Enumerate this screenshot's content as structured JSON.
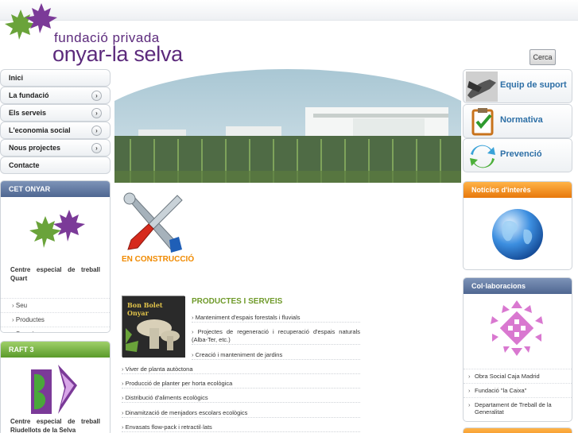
{
  "header": {
    "logo_line1": "fundació privada",
    "logo_line2": "onyar-la selva",
    "search_label": "Cerca"
  },
  "nav": [
    {
      "label": "Inici",
      "has_arrow": false
    },
    {
      "label": "La fundació",
      "has_arrow": true
    },
    {
      "label": "Els serveis",
      "has_arrow": true
    },
    {
      "label": "L'economia social",
      "has_arrow": true
    },
    {
      "label": "Nous projectes",
      "has_arrow": true
    },
    {
      "label": "Contacte",
      "has_arrow": false
    }
  ],
  "cet": {
    "title": "CET ONYAR",
    "text": "Centre especial de treball Quart",
    "links": [
      "Seu",
      "Productes",
      "Serveis"
    ]
  },
  "raft": {
    "title": "RAFT 3",
    "text": "Centre especial de treball Riudellots de la Selva"
  },
  "main": {
    "construction_label": "EN CONSTRUCCIÓ",
    "products_title": "PRODUCTES I SERVEIS",
    "product_image_text": "Bon Bolet Onyar",
    "services_sub": [
      "Manteniment d'espais forestals i fluvials",
      "Projectes de regeneració i recuperació d'espais naturals (Alba-Ter, etc.)",
      "Creació i manteniment de jardins"
    ],
    "services": [
      "Viver de planta autòctona",
      "Producció de planter per horta ecològica",
      "Distribució d'aliments ecològics",
      "Dinamització de menjadors escolars ecològics",
      "Envasats flow-pack i retractil·lats"
    ]
  },
  "right": {
    "buttons": [
      "Equip de suport",
      "Normativa",
      "Prevenció"
    ],
    "news_title": "Notícies d'interès",
    "collab_title": "Col·laboracions",
    "collab_links": [
      "Obra Social Caja Madrid",
      "Fundació \"la Caixa\"",
      "Departament de Treball de la Generalitat"
    ]
  },
  "colors": {
    "brand_purple": "#5c2a7c",
    "leaf_green": "#5a9a2a",
    "accent_orange": "#f08a00",
    "heading_green": "#6f9a2a",
    "link_blue": "#2d6fa6"
  }
}
